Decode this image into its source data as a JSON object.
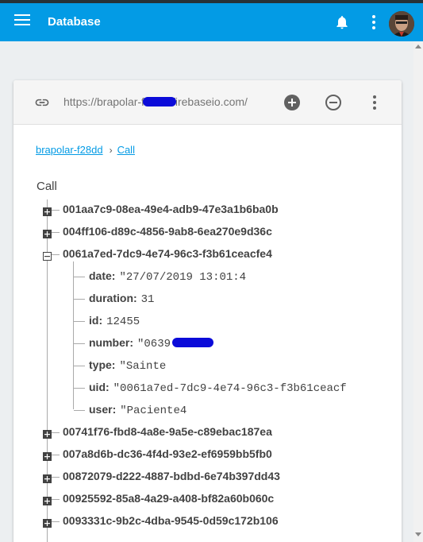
{
  "appbar": {
    "title": "Database",
    "icons": [
      "menu-icon",
      "bell-icon",
      "more-vert-icon"
    ]
  },
  "database": {
    "url": "https://brapolar-f28dd.firebaseio.com/",
    "breadcrumb": [
      "brapolar-f28dd",
      "Call"
    ],
    "root": "Call",
    "nodes_before": [
      "001aa7c9-08ea-49e4-adb9-47e3a1b6ba0b",
      "004ff106-d89c-4856-9ab8-6ea270e9d36c"
    ],
    "expanded": {
      "key": "0061a7ed-7dc9-4e74-96c3-f3b61ceacfe4",
      "fields": [
        {
          "key": "date:",
          "value": "\"27/07/2019 13:01:4"
        },
        {
          "key": "duration:",
          "value": "31"
        },
        {
          "key": "id:",
          "value": "12455"
        },
        {
          "key": "number:",
          "value": "\"0639          781"
        },
        {
          "key": "type:",
          "value": "\"Sainte"
        },
        {
          "key": "uid:",
          "value": "\"0061a7ed-7dc9-4e74-96c3-f3b61ceacf"
        },
        {
          "key": "user:",
          "value": "\"Paciente4"
        }
      ]
    },
    "nodes_after": [
      "00741f76-fbd8-4a8e-9a5e-c89ebac187ea",
      "007a8d6b-dc36-4f4d-93e2-ef6959bb5fb0",
      "00872079-d222-4887-bdbd-6e74b397dd43",
      "00925592-85a8-4a29-a408-bf82a60b060c",
      "0093331c-9b2c-4dba-9545-0d59c172b106"
    ]
  },
  "colors": {
    "appbar": "#039be5",
    "link": "#039be5",
    "redaction": "#0b0bd9"
  }
}
